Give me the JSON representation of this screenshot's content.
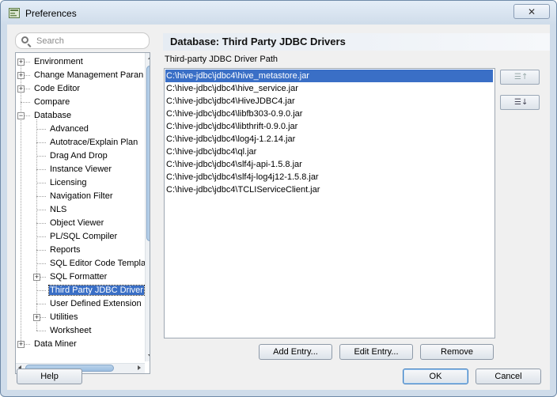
{
  "window": {
    "title": "Preferences",
    "close_glyph": "✕"
  },
  "search": {
    "placeholder": "Search"
  },
  "tree": [
    {
      "label": "Environment",
      "level": 0,
      "expander": "+"
    },
    {
      "label": "Change Management Paran",
      "level": 0,
      "expander": "+"
    },
    {
      "label": "Code Editor",
      "level": 0,
      "expander": "+"
    },
    {
      "label": "Compare",
      "level": 0,
      "expander": ""
    },
    {
      "label": "Database",
      "level": 0,
      "expander": "−"
    },
    {
      "label": "Advanced",
      "level": 1,
      "expander": ""
    },
    {
      "label": "Autotrace/Explain Plan",
      "level": 1,
      "expander": ""
    },
    {
      "label": "Drag And Drop",
      "level": 1,
      "expander": ""
    },
    {
      "label": "Instance Viewer",
      "level": 1,
      "expander": ""
    },
    {
      "label": "Licensing",
      "level": 1,
      "expander": ""
    },
    {
      "label": "Navigation Filter",
      "level": 1,
      "expander": ""
    },
    {
      "label": "NLS",
      "level": 1,
      "expander": ""
    },
    {
      "label": "Object Viewer",
      "level": 1,
      "expander": ""
    },
    {
      "label": "PL/SQL Compiler",
      "level": 1,
      "expander": ""
    },
    {
      "label": "Reports",
      "level": 1,
      "expander": ""
    },
    {
      "label": "SQL Editor Code Templa",
      "level": 1,
      "expander": ""
    },
    {
      "label": "SQL Formatter",
      "level": 1,
      "expander": "+"
    },
    {
      "label": "Third Party JDBC Driver",
      "level": 1,
      "expander": "",
      "selected": true
    },
    {
      "label": "User Defined Extension",
      "level": 1,
      "expander": ""
    },
    {
      "label": "Utilities",
      "level": 1,
      "expander": "+"
    },
    {
      "label": "Worksheet",
      "level": 1,
      "expander": ""
    },
    {
      "label": "Data Miner",
      "level": 0,
      "expander": "+"
    }
  ],
  "panel": {
    "title": "Database: Third Party JDBC Drivers",
    "path_label": "Third-party JDBC Driver Path",
    "drivers": [
      "C:\\hive-jdbc\\jdbc4\\hive_metastore.jar",
      "C:\\hive-jdbc\\jdbc4\\hive_service.jar",
      "C:\\hive-jdbc\\jdbc4\\HiveJDBC4.jar",
      "C:\\hive-jdbc\\jdbc4\\libfb303-0.9.0.jar",
      "C:\\hive-jdbc\\jdbc4\\libthrift-0.9.0.jar",
      "C:\\hive-jdbc\\jdbc4\\log4j-1.2.14.jar",
      "C:\\hive-jdbc\\jdbc4\\ql.jar",
      "C:\\hive-jdbc\\jdbc4\\slf4j-api-1.5.8.jar",
      "C:\\hive-jdbc\\jdbc4\\slf4j-log4j12-1.5.8.jar",
      "C:\\hive-jdbc\\jdbc4\\TCLIServiceClient.jar"
    ],
    "selected_index": 0,
    "move_up_glyph": "☰↑",
    "move_down_glyph": "☰↓",
    "add_label": "Add Entry...",
    "edit_label": "Edit Entry...",
    "remove_label": "Remove"
  },
  "footer": {
    "help_label": "Help",
    "ok_label": "OK",
    "cancel_label": "Cancel"
  },
  "colors": {
    "selection": "#3a6fc6",
    "frame": "#cfdcea",
    "client": "#f0f0f0"
  }
}
